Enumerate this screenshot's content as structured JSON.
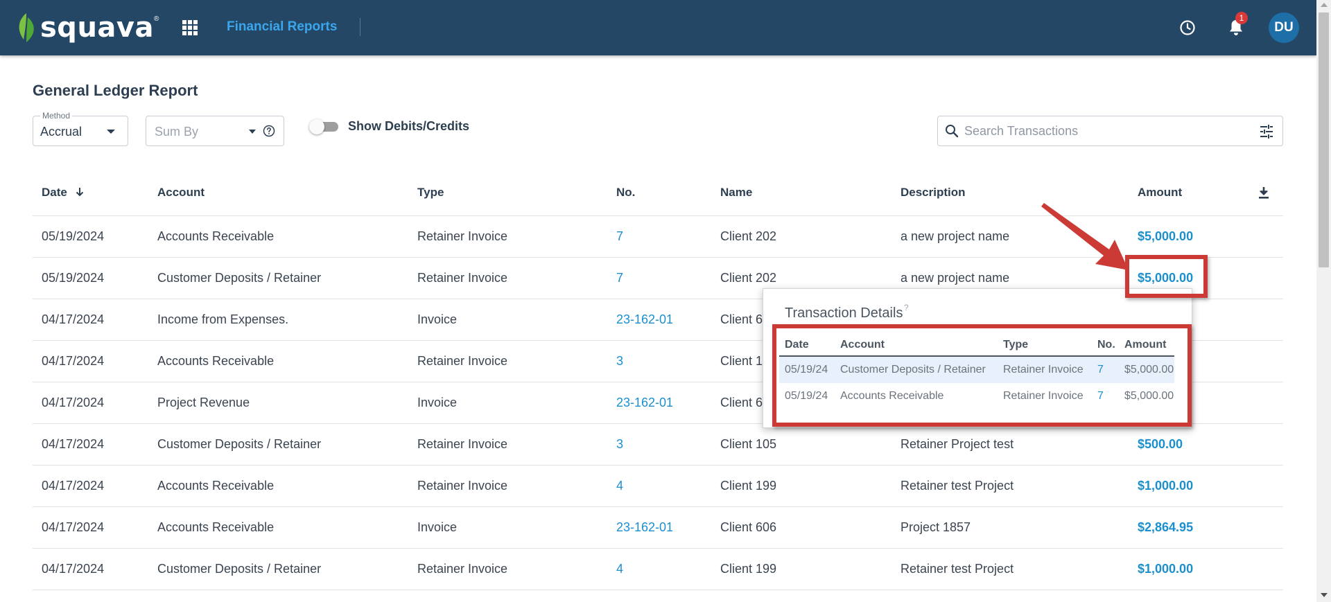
{
  "header": {
    "logo_text": "squava",
    "logo_mark": "®",
    "app_title": "Financial Reports",
    "notification_count": "1",
    "avatar_initials": "DU",
    "bg_color": "#254766",
    "accent_color": "#3aa6ee"
  },
  "page": {
    "title": "General Ledger Report"
  },
  "filters": {
    "method_label": "Method",
    "method_value": "Accrual",
    "sumby_placeholder": "Sum By",
    "toggle_label": "Show Debits/Credits",
    "toggle_on": false,
    "search_placeholder": "Search Transactions"
  },
  "table": {
    "columns": [
      "Date",
      "Account",
      "Type",
      "No.",
      "Name",
      "Description",
      "Amount"
    ],
    "rows": [
      {
        "date": "05/19/2024",
        "account": "Accounts Receivable",
        "type": "Retainer Invoice",
        "no": "7",
        "name": "Client 202",
        "description": "a new project name",
        "amount": "$5,000.00"
      },
      {
        "date": "05/19/2024",
        "account": "Customer Deposits / Retainer",
        "type": "Retainer Invoice",
        "no": "7",
        "name": "Client 202",
        "description": "a new project name",
        "amount": "$5,000.00"
      },
      {
        "date": "04/17/2024",
        "account": "Income from Expenses.",
        "type": "Invoice",
        "no": "23-162-01",
        "name": "Client 6",
        "description": "",
        "amount": ""
      },
      {
        "date": "04/17/2024",
        "account": "Accounts Receivable",
        "type": "Retainer Invoice",
        "no": "3",
        "name": "Client 1",
        "description": "",
        "amount": ""
      },
      {
        "date": "04/17/2024",
        "account": "Project Revenue",
        "type": "Invoice",
        "no": "23-162-01",
        "name": "Client 6",
        "description": "",
        "amount": ""
      },
      {
        "date": "04/17/2024",
        "account": "Customer Deposits / Retainer",
        "type": "Retainer Invoice",
        "no": "3",
        "name": "Client 105",
        "description": "Retainer Project test",
        "amount": "$500.00"
      },
      {
        "date": "04/17/2024",
        "account": "Accounts Receivable",
        "type": "Retainer Invoice",
        "no": "4",
        "name": "Client 199",
        "description": "Retainer test Project",
        "amount": "$1,000.00"
      },
      {
        "date": "04/17/2024",
        "account": "Accounts Receivable",
        "type": "Invoice",
        "no": "23-162-01",
        "name": "Client 606",
        "description": "Project 1857",
        "amount": "$2,864.95"
      },
      {
        "date": "04/17/2024",
        "account": "Customer Deposits / Retainer",
        "type": "Retainer Invoice",
        "no": "4",
        "name": "Client 199",
        "description": "Retainer test Project",
        "amount": "$1,000.00"
      }
    ]
  },
  "popover": {
    "title": "Transaction Details",
    "help_mark": "?",
    "columns": [
      "Date",
      "Account",
      "Type",
      "No.",
      "Amount"
    ],
    "rows": [
      {
        "date": "05/19/24",
        "account": "Customer Deposits / Retainer",
        "type": "Retainer Invoice",
        "no": "7",
        "amount": "$5,000.00"
      },
      {
        "date": "05/19/24",
        "account": "Accounts Receivable",
        "type": "Retainer Invoice",
        "no": "7",
        "amount": "$5,000.00"
      }
    ]
  },
  "annotation": {
    "color": "#cc3a36"
  },
  "icons": {
    "apps": "apps-grid-icon",
    "history": "clock-icon",
    "notifications": "bell-icon",
    "sort": "arrow-down-icon",
    "download": "download-icon",
    "search": "search-icon",
    "filter": "tune-icon",
    "help": "help-circle-icon"
  }
}
